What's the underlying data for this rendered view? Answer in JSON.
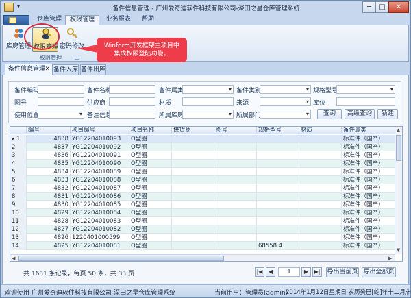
{
  "window": {
    "title": "备件信息管理 - 广州爱奇迪软件科技有限公司-深田之星仓库管理系统",
    "minimize": "─",
    "maximize": "□",
    "close": "✕"
  },
  "ribbon": {
    "tabs": [
      {
        "label": "仓库管理"
      },
      {
        "label": "权限管理"
      },
      {
        "label": "业务报表"
      },
      {
        "label": "帮助"
      }
    ],
    "buttons": [
      {
        "label": "库房管理",
        "icon": "users-icon"
      },
      {
        "label": "权限管理",
        "icon": "key-user-icon"
      },
      {
        "label": "密码修改",
        "icon": "key-icon"
      }
    ],
    "group_label": "权限管理"
  },
  "callout": {
    "line1": "Winform开发框架主项目中",
    "line2": "集成权限登陆功能。"
  },
  "doc_tabs": [
    {
      "label": "备件信息管理",
      "close": "✕"
    },
    {
      "label": "备件入库"
    },
    {
      "label": "备件出库"
    }
  ],
  "query": {
    "row1": [
      "备件编码",
      "备件名称",
      "备件属类",
      "备件类别",
      "规格型号"
    ],
    "row2": [
      "图号",
      "供应商",
      "材质",
      "来源",
      "库位"
    ],
    "row3": [
      "使用位置",
      "备注信息",
      "所属库房",
      "所属部门"
    ],
    "buttons": [
      "查询",
      "高级查询",
      "新建"
    ]
  },
  "grid": {
    "columns": [
      "",
      "编号",
      "项目编号",
      "项目名称",
      "供货商",
      "图号",
      "规格型号",
      "材质",
      "备件属类"
    ],
    "rows": [
      {
        "n": "1",
        "id": "4838",
        "proj": "YG12204010093",
        "name": "O型圈",
        "spec": "",
        "cat": "标准件（国产）"
      },
      {
        "n": "2",
        "id": "4837",
        "proj": "YG12204010092",
        "name": "O型圈",
        "spec": "",
        "cat": "标准件（国产）"
      },
      {
        "n": "3",
        "id": "4836",
        "proj": "YG12204010091",
        "name": "O型圈",
        "spec": "",
        "cat": "标准件（国产）"
      },
      {
        "n": "4",
        "id": "4835",
        "proj": "YG12204010090",
        "name": "O型圈",
        "spec": "",
        "cat": "标准件（国产）"
      },
      {
        "n": "5",
        "id": "4834",
        "proj": "YG12204010089",
        "name": "O型圈",
        "spec": "",
        "cat": "标准件（国产）"
      },
      {
        "n": "6",
        "id": "4833",
        "proj": "YG12204010088",
        "name": "O型圈",
        "spec": "",
        "cat": "标准件（国产）"
      },
      {
        "n": "7",
        "id": "4832",
        "proj": "YG12204010087",
        "name": "O型圈",
        "spec": "",
        "cat": "标准件（国产）"
      },
      {
        "n": "8",
        "id": "4831",
        "proj": "YG12204010086",
        "name": "O型圈",
        "spec": "",
        "cat": "标准件（国产）"
      },
      {
        "n": "9",
        "id": "4830",
        "proj": "YG12204010085",
        "name": "O型圈",
        "spec": "",
        "cat": "标准件（国产）"
      },
      {
        "n": "10",
        "id": "4829",
        "proj": "YG12204010084",
        "name": "O型圈",
        "spec": "",
        "cat": "标准件（国产）"
      },
      {
        "n": "11",
        "id": "4828",
        "proj": "YG12204010083",
        "name": "O型圈",
        "spec": "",
        "cat": "标准件（国产）"
      },
      {
        "n": "12",
        "id": "4827",
        "proj": "YG12204010082",
        "name": "O型圈",
        "spec": "",
        "cat": "标准件（国产）"
      },
      {
        "n": "13",
        "id": "4826",
        "proj": "1220401000599",
        "name": "O型圈",
        "spec": "",
        "cat": "标准件（国产）"
      },
      {
        "n": "14",
        "id": "4825",
        "proj": "YG12204010081",
        "name": "O型圈",
        "spec": "68558.4",
        "cat": "标准件（国产）"
      }
    ]
  },
  "pager": {
    "info": "共 1631 条记录，每页 50 条，共 33 页",
    "page": "1",
    "first": "|◀",
    "prev": "◀",
    "next": "▶",
    "last": "▶|",
    "export_page": "导出当前页",
    "export_all": "导出全部页"
  },
  "status": {
    "left": "欢迎使用 广州爱奇迪软件科技有限公司-深田之星仓库管理系统",
    "user": "当前用户：管理员(admin)",
    "date": "2014年1月12日星期日 农历癸巳[蛇]年十二月十二"
  }
}
